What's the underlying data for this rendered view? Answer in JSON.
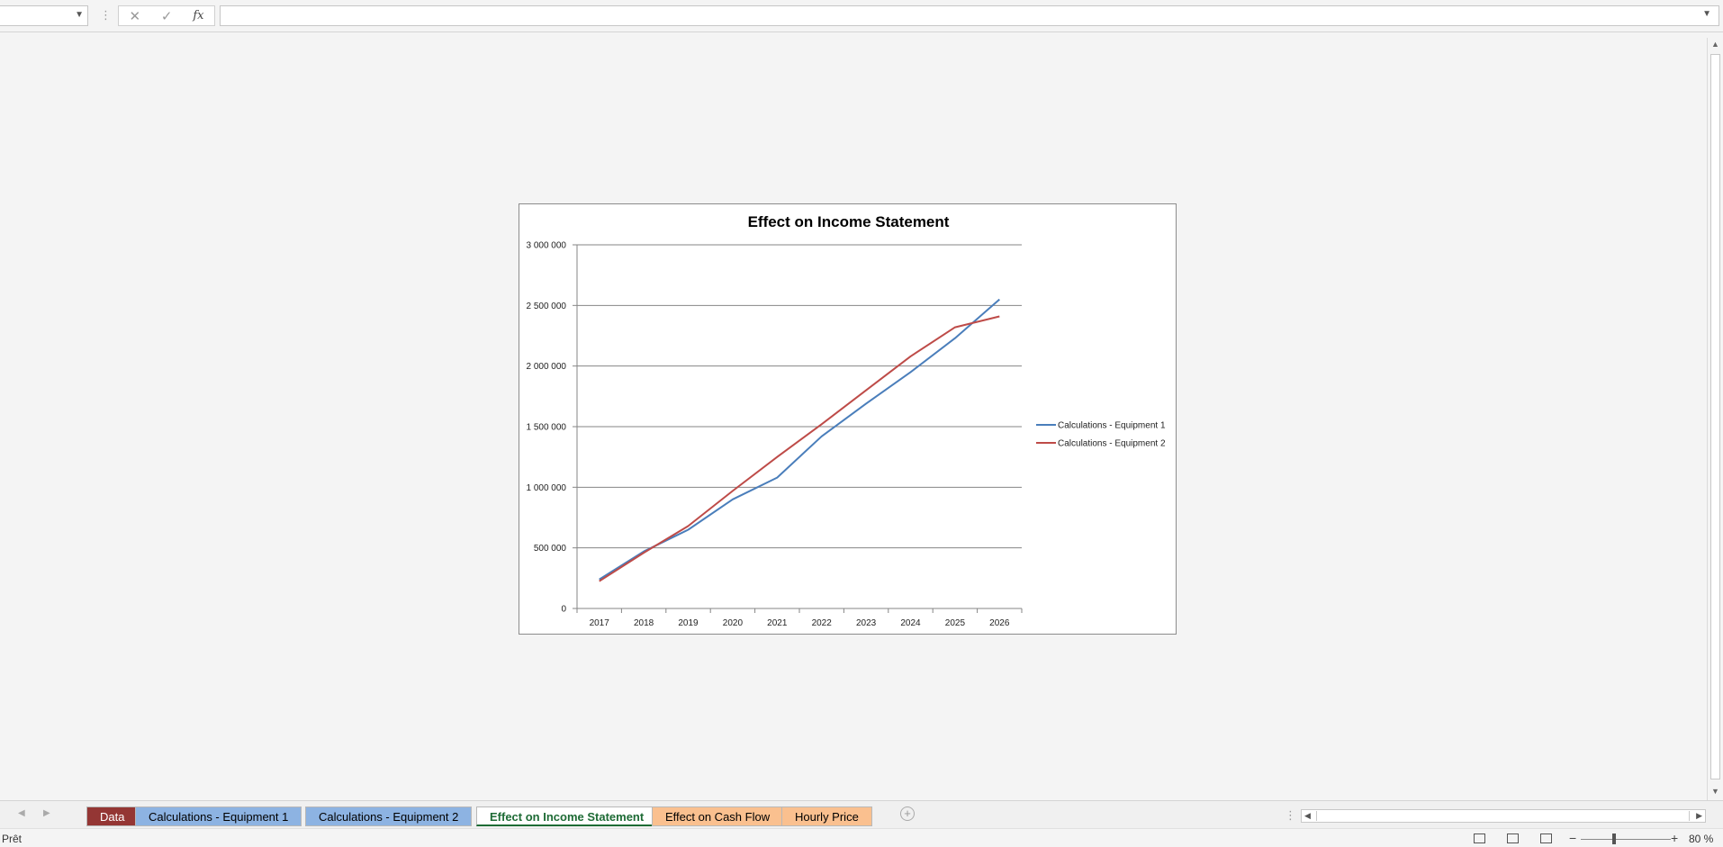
{
  "formula_bar": {
    "cancel_icon": "✕",
    "enter_icon": "✓",
    "fx_label": "fx",
    "formula_value": ""
  },
  "sheet_tabs": [
    {
      "label": "Data",
      "color": "#943634",
      "text_color": "#ffffff"
    },
    {
      "label": "Calculations - Equipment 1",
      "color": "#8db3e2",
      "text_color": "#000000"
    },
    {
      "label": "Calculations - Equipment 2",
      "color": "#8db3e2",
      "text_color": "#000000"
    },
    {
      "label": "Effect on Income Statement",
      "color": "#ffffff",
      "text_color": "#1e6b35",
      "active": true
    },
    {
      "label": "Effect on Cash Flow",
      "color": "#fac08f",
      "text_color": "#000000"
    },
    {
      "label": "Hourly Price",
      "color": "#fac08f",
      "text_color": "#000000"
    }
  ],
  "status_bar": {
    "status": "Prêt",
    "zoom": "80 %"
  },
  "chart_data": {
    "type": "line",
    "title": "Effect on Income Statement",
    "xlabel": "",
    "ylabel": "",
    "categories": [
      "2017",
      "2018",
      "2019",
      "2020",
      "2021",
      "2022",
      "2023",
      "2024",
      "2025",
      "2026"
    ],
    "ylim": [
      0,
      3000000
    ],
    "yticks": [
      0,
      500000,
      1000000,
      1500000,
      2000000,
      2500000,
      3000000
    ],
    "ytick_labels": [
      "0",
      "500 000",
      "1 000 000",
      "1 500 000",
      "2 000 000",
      "2 500 000",
      "3 000 000"
    ],
    "grid": true,
    "legend_position": "right",
    "series": [
      {
        "name": "Calculations - Equipment 1",
        "color": "#4a7ebb",
        "values": [
          240000,
          470000,
          650000,
          900000,
          1080000,
          1420000,
          1690000,
          1950000,
          2230000,
          2550000
        ]
      },
      {
        "name": "Calculations - Equipment 2",
        "color": "#be4b48",
        "values": [
          225000,
          460000,
          680000,
          970000,
          1250000,
          1520000,
          1800000,
          2080000,
          2320000,
          2410000
        ]
      }
    ]
  }
}
